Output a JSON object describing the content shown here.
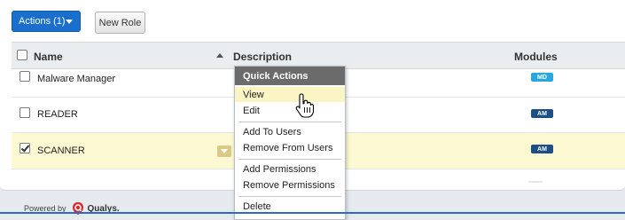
{
  "toolbar": {
    "actions_label": "Actions (1)",
    "new_role_label": "New Role"
  },
  "table": {
    "columns": [
      "Name",
      "Description",
      "Modules"
    ],
    "rows": [
      {
        "name": "Malware Manager",
        "checked": false,
        "module": "MD"
      },
      {
        "name": "READER",
        "checked": false,
        "module": "AM"
      },
      {
        "name": "SCANNER",
        "checked": true,
        "module": "AM"
      }
    ]
  },
  "menu": {
    "title": "Quick Actions",
    "items": [
      "View",
      "Edit",
      "Add To Users",
      "Remove From Users",
      "Add Permissions",
      "Remove Permissions",
      "Delete"
    ],
    "hovered": "View"
  },
  "footer": {
    "powered_by": "Powered by",
    "brand": "Qualys."
  },
  "colors": {
    "primary_button": "#1a6fce",
    "selected_row": "#fcf8d2",
    "menu_header": "#6b6b6b",
    "badge_md": "#29a7e1",
    "badge_am": "#1d4f86",
    "brand_red": "#d9262c"
  }
}
